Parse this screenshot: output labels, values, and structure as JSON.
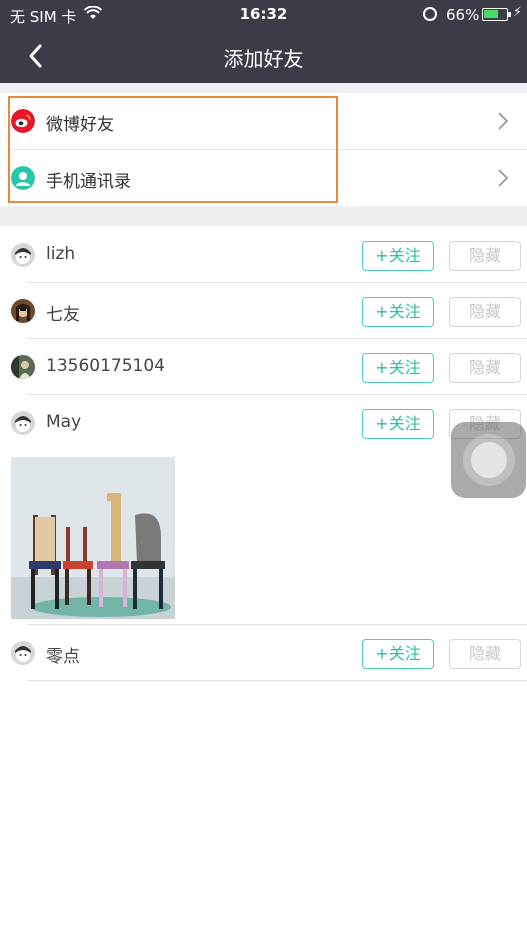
{
  "status_bar": {
    "carrier": "无 SIM 卡",
    "time": "16:32",
    "battery_percent": "66%",
    "battery_level": 0.66
  },
  "nav": {
    "title": "添加好友"
  },
  "entries": [
    {
      "label": "微博好友",
      "icon": "weibo-icon"
    },
    {
      "label": "手机通讯录",
      "icon": "contacts-icon"
    }
  ],
  "buttons": {
    "follow": "+关注",
    "hide": "隐藏"
  },
  "friends": [
    {
      "name": "lizh"
    },
    {
      "name": "七友"
    },
    {
      "name": "13560175104"
    },
    {
      "name": "May"
    },
    {
      "name": "零点"
    }
  ],
  "colors": {
    "header_bg": "#3a3d47",
    "accent": "#4ecfb8",
    "highlight": "#e8893a",
    "weibo": "#e6162d"
  }
}
